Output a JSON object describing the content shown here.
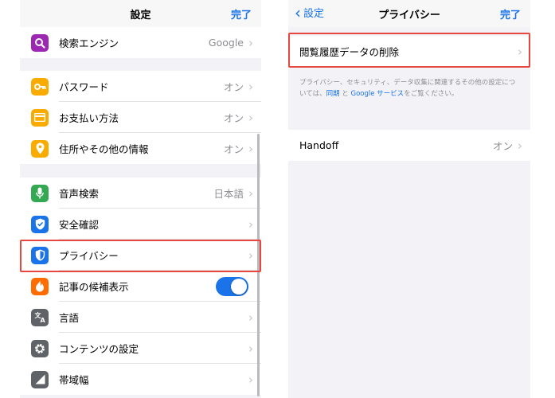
{
  "left": {
    "nav": {
      "title": "設定",
      "done": "完了"
    },
    "rows": [
      {
        "label": "検索エンジン",
        "value": "Google",
        "icon": "search-icon",
        "color": "#9c27b0"
      },
      {
        "label": "パスワード",
        "value": "オン",
        "icon": "key-icon",
        "color": "#f9ab00"
      },
      {
        "label": "お支払い方法",
        "value": "オン",
        "icon": "credit-card-icon",
        "color": "#f9ab00"
      },
      {
        "label": "住所やその他の情報",
        "value": "オン",
        "icon": "location-pin-icon",
        "color": "#f9ab00"
      },
      {
        "label": "音声検索",
        "value": "日本語",
        "icon": "microphone-icon",
        "color": "#34a853"
      },
      {
        "label": "安全確認",
        "value": "",
        "icon": "shield-check-icon",
        "color": "#1a73e8"
      },
      {
        "label": "プライバシー",
        "value": "",
        "icon": "shield-privacy-icon",
        "color": "#1a73e8"
      },
      {
        "label": "記事の候補表示",
        "value": "",
        "icon": "flame-icon",
        "color": "#ff6d00"
      },
      {
        "label": "言語",
        "value": "",
        "icon": "translate-icon",
        "color": "#5f6368"
      },
      {
        "label": "コンテンツの設定",
        "value": "",
        "icon": "gear-icon",
        "color": "#5f6368"
      },
      {
        "label": "帯域幅",
        "value": "",
        "icon": "signal-icon",
        "color": "#5f6368"
      }
    ]
  },
  "right": {
    "nav": {
      "back": "設定",
      "title": "プライバシー",
      "done": "完了"
    },
    "clear_row": {
      "label": "閲覧履歴データの削除"
    },
    "footnote": {
      "text1": "プライバシー、セキュリティ、データ収集に関連するその他の設定については、",
      "link1": "同期",
      "text2": " と ",
      "link2": "Google サービス",
      "text3": "をご覧ください。"
    },
    "handoff_row": {
      "label": "Handoff",
      "value": "オン"
    }
  },
  "colors": {
    "accent": "#1a73e8",
    "highlight": "#e8473f"
  }
}
